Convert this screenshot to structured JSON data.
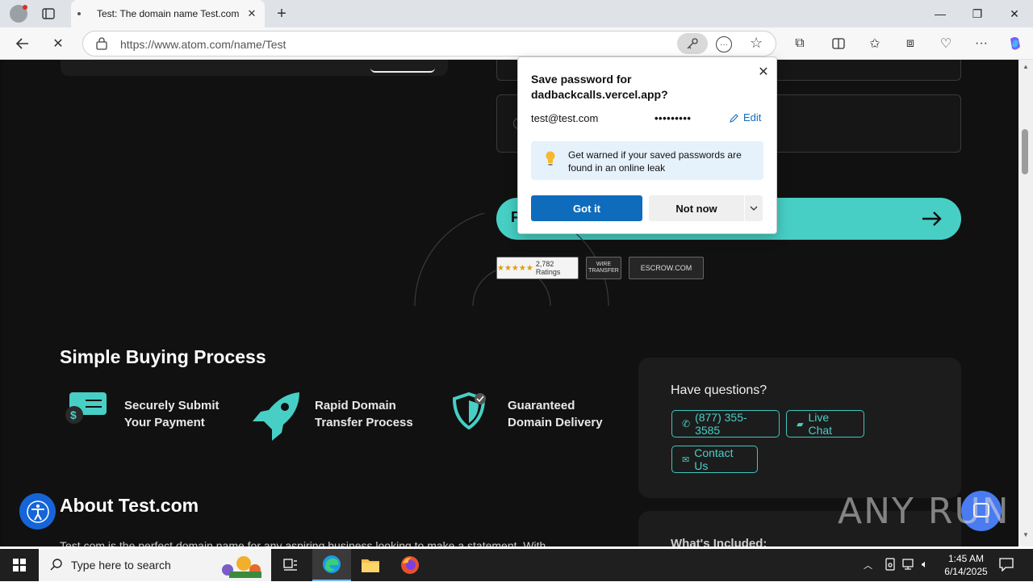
{
  "browser": {
    "tab_title": "Test: The domain name Test.com is",
    "url": "https://www.atom.com/name/Test"
  },
  "page": {
    "section_title": "Simple Buying Process",
    "steps": [
      {
        "label": "Securely Submit Your Payment"
      },
      {
        "label": "Rapid Domain Transfer Process"
      },
      {
        "label": "Guaranteed Domain Delivery"
      }
    ],
    "questions": {
      "title": "Have questions?",
      "phone": "(877) 355-3585",
      "live_chat": "Live Chat",
      "contact": "Contact Us"
    },
    "about_title": "About Test.com",
    "about_body": "Test.com is the perfect domain name for any aspiring business looking to make a statement. With",
    "included_title": "What's Included:",
    "badges": [
      "2,782 Ratings",
      "WIRE TRANSFER",
      "ESCROW.COM"
    ],
    "cta_letter": "F",
    "accent": "#47cfc5"
  },
  "password_popup": {
    "title": "Save password for dadbackcalls.vercel.app?",
    "username": "test@test.com",
    "password_mask": "•••••••••",
    "edit_label": "Edit",
    "info_text": "Get warned if your saved passwords are found in an online leak",
    "got_it": "Got it",
    "not_now": "Not now"
  },
  "watermark": "ANY RUN",
  "taskbar": {
    "search_placeholder": "Type here to search",
    "time": "1:45 AM",
    "date": "6/14/2025"
  }
}
